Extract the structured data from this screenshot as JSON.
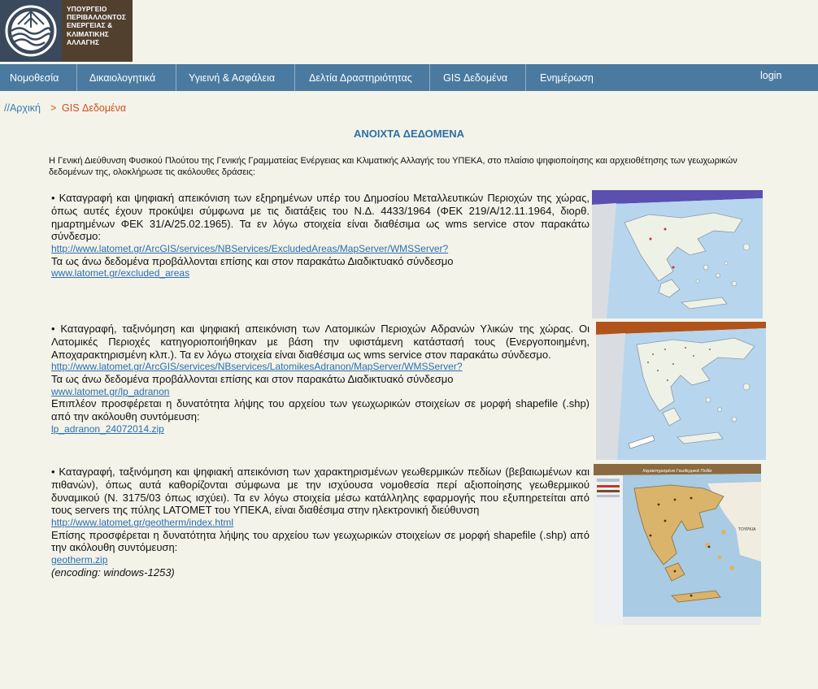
{
  "logo": {
    "lines": [
      "ΥΠΟΥΡΓΕΙΟ",
      "ΠΕΡΙΒΑΛΛΟΝΤΟΣ",
      "ΕΝΕΡΓΕΙΑΣ &",
      "ΚΛΙΜΑΤΙΚΗΣ",
      "ΑΛΛΑΓΗΣ"
    ],
    "colors": {
      "panel": "#52402f",
      "emblem": "#3a4a5c"
    }
  },
  "nav": {
    "items": [
      "Νομοθεσία",
      "Δικαιολογητικά",
      "Υγιεινή & Ασφάλεια",
      "Δελτία Δραστηριότητας",
      "GIS Δεδομένα",
      "Ενημέρωση"
    ],
    "login": "login",
    "color": "#4b7aa0"
  },
  "breadcrumb": {
    "home": "//Αρχική",
    "separator": ">",
    "current": "GIS Δεδομένα"
  },
  "title": "ΑΝΟΙΧΤΑ ΔΕΔΟΜΕΝΑ",
  "intro": "Η Γενική Διεύθυνση Φυσικού Πλούτου της Γενικής Γραμματείας Ενέργειας και Κλιματικής Αλλαγής του ΥΠΕΚΑ, στο πλαίσιο ψηφιοποίησης και αρχειοθέτησης των γεωχωρικών δεδομένων της, ολοκλήρωσε τις ακόλουθες δράσεις:",
  "sections": [
    {
      "text": "• Καταγραφή και ψηφιακή απεικόνιση των εξηρημένων υπέρ του Δημοσίου Μεταλλευτικών Περιοχών της χώρας, όπως αυτές έχουν προκύψει σύμφωνα με τις διατάξεις του Ν.Δ. 4433/1964 (ΦΕΚ 219/Α/12.11.1964, διορθ. ημαρτημένων ΦΕΚ 31/Α/25.02.1965). Τα εν λόγω στοιχεία είναι διαθέσιμα ως wms service στον παρακάτω σύνδεσμο:",
      "link1": "http://www.latomet.gr/ArcGIS/services/NBServices/ExcludedAreas/MapServer/WMSServer?",
      "text2": "Τα ως άνω δεδομένα προβάλλονται επίσης και στον παρακάτω Διαδικτυακό σύνδεσμο",
      "link2": "www.latomet.gr/excluded_areas"
    },
    {
      "text": "• Καταγραφή, ταξινόμηση και ψηφιακή απεικόνιση των Λατομικών Περιοχών Αδρανών Υλικών της χώρας. Οι Λατομικές Περιοχές κατηγοριοποιήθηκαν με βάση την υφιστάμενη κατάστασή τους (Ενεργοποιημένη, Αποχαρακτηρισμένη κλπ.). Τα εν λόγω στοιχεία είναι διαθέσιμα ως wms service στον παρακάτω σύνδεσμο.",
      "link1": "http://www.latomet.gr/ArcGIS/services/NBservices/LatomikesAdranon/MapServer/WMSServer?",
      "text2": "Τα ως άνω δεδομένα προβάλλονται επίσης και στον παρακάτω Διαδικτυακό σύνδεσμο",
      "link2": "www.latomet.gr/lp_adranon",
      "text3": "Επιπλέον προσφέρεται η δυνατότητα λήψης του αρχείου των γεωχωρικών στοιχείων σε μορφή shapefile (.shp) από την ακόλουθη συντόμευση:",
      "link3": "lp_adranon_24072014.zip"
    },
    {
      "text": "• Καταγραφή, ταξινόμηση και ψηφιακή απεικόνιση των χαρακτηρισμένων γεωθερμικών πεδίων (βεβαιωμένων και πιθανών), όπως αυτά καθορίζονται σύμφωνα με την ισχύουσα νομοθεσία περί αξιοποίησης γεωθερμικού δυναμικού (Ν. 3175/03 όπως ισχύει). Τα εν λόγω στοιχεία μέσω κατάλληλης εφαρμογής που εξυπηρετείται από τους servers της πύλης LATOMET του ΥΠΕΚΑ, είναι διαθέσιμα στην ηλεκτρονική διεύθυνση",
      "link1": "http://www.latomet.gr/geotherm/index.html",
      "text2": "Επίσης προσφέρεται η δυνατότητα λήψης του αρχείου των γεωχωρικών στοιχείων σε μορφή shapefile (.shp) από την ακόλουθη συντόμευση:",
      "link2": "geotherm.zip",
      "encoding": "(encoding: windows-1253)"
    }
  ],
  "maps": {
    "map3_title": "Χαρακτηρισμένα Γεωθερμικά Πεδία",
    "map3_label": "ΤΟΥΡΚΙΑ"
  }
}
